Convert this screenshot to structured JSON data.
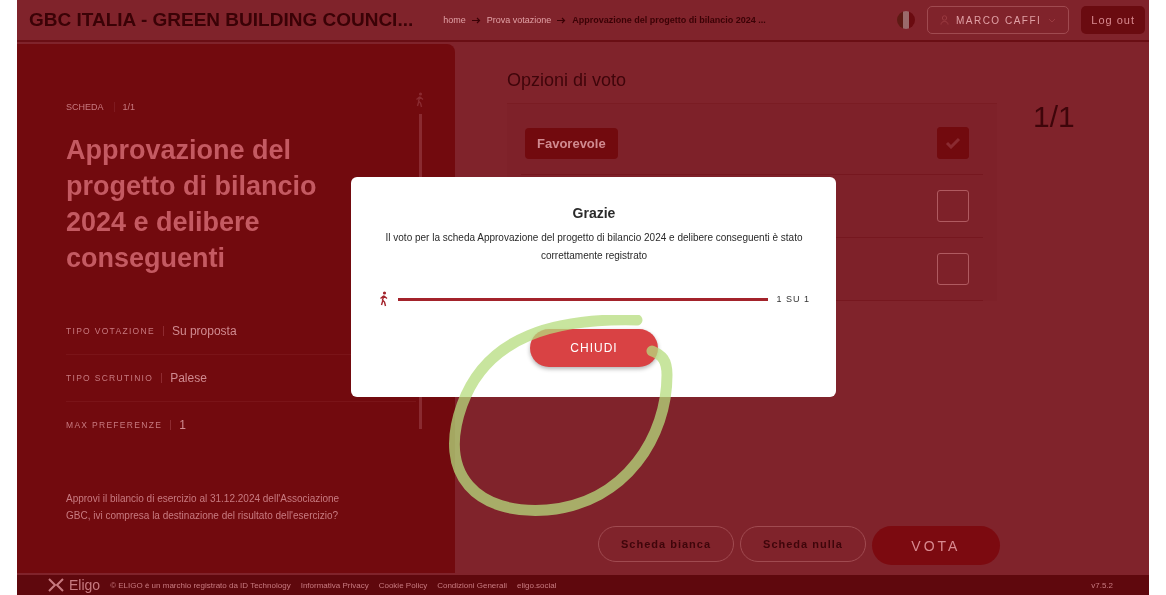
{
  "header": {
    "title": "GBC ITALIA - GREEN BUILDING COUNCI...",
    "breadcrumbs": [
      "home",
      "Prova votazione",
      "Approvazione del progetto di bilancio 2024 ..."
    ],
    "user": "MARCO CAFFI",
    "logout": "Log out"
  },
  "ballot": {
    "label": "SCHEDA",
    "count": "1/1",
    "title": "Approvazione del progetto di bilancio 2024 e delibere conseguenti",
    "details": [
      {
        "label": "TIPO VOTAZIONE",
        "value": "Su proposta"
      },
      {
        "label": "TIPO SCRUTINIO",
        "value": "Palese"
      },
      {
        "label": "MAX PREFERENZE",
        "value": "1"
      }
    ],
    "question": "Approvi il bilancio di esercizio al 31.12.2024 dell'Associazione GBC, ivi compresa la destinazione del risultato dell'esercizio?"
  },
  "options": {
    "title": "Opzioni di voto",
    "counter": "1/1",
    "items": [
      {
        "label": "Favorevole",
        "checked": true
      },
      {
        "checked": false
      },
      {
        "checked": false
      }
    ]
  },
  "actions": [
    "Scheda bianca",
    "Scheda nulla",
    "VOTA"
  ],
  "dialog": {
    "title": "Grazie",
    "message": "Il voto per la scheda Approvazione del progetto di bilancio 2024 e delibere conseguenti è stato correttamente registrato",
    "progress": {
      "level": 1,
      "reading": "1 SU 1"
    },
    "button": "CHIUDI"
  },
  "footer": {
    "brand": "Eligo",
    "links": [
      "© ELIGO è un marchio registrato da ID Technology",
      "Informativa Privacy",
      "Cookie Policy",
      "Condizioni Generali",
      "eligo.social"
    ],
    "version": "v7.5.2"
  }
}
